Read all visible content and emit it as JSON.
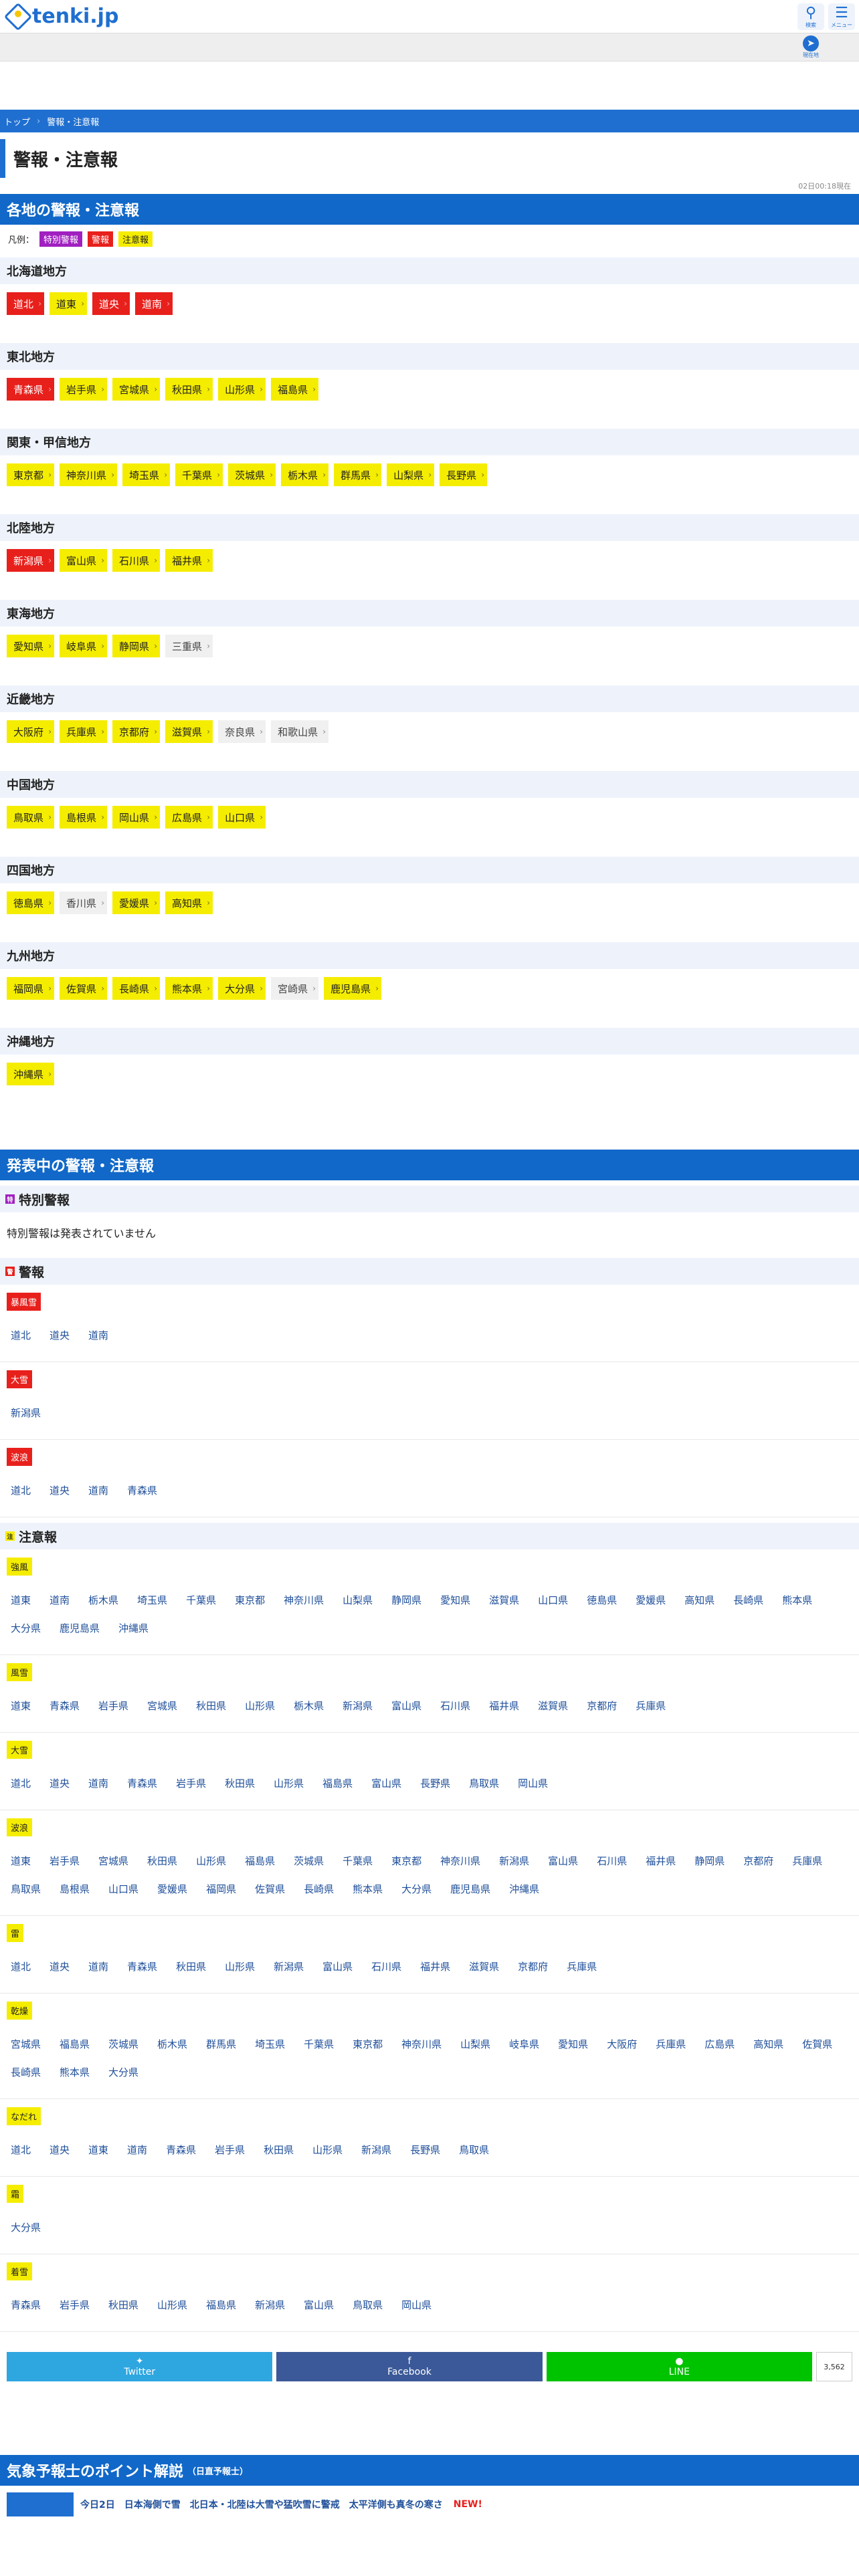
{
  "site": {
    "logo": "tenki.jp"
  },
  "header": {
    "search_label": "検索",
    "menu_label": "メニュー"
  },
  "subbar": {
    "location_label": "現在地"
  },
  "breadcrumb": [
    "トップ",
    "警報・注意報"
  ],
  "page_title": "警報・注意報",
  "as_of": "02日00:18現在",
  "section1_title": "各地の警報・注意報",
  "legend": {
    "label": "凡例：",
    "special": "特別警報",
    "warning": "警報",
    "advisory": "注意報"
  },
  "regions": [
    {
      "name": "北海道地方",
      "areas": [
        {
          "n": "道北",
          "s": "w"
        },
        {
          "n": "道東",
          "s": "a"
        },
        {
          "n": "道央",
          "s": "w"
        },
        {
          "n": "道南",
          "s": "w"
        }
      ]
    },
    {
      "name": "東北地方",
      "areas": [
        {
          "n": "青森県",
          "s": "w"
        },
        {
          "n": "岩手県",
          "s": "a"
        },
        {
          "n": "宮城県",
          "s": "a"
        },
        {
          "n": "秋田県",
          "s": "a"
        },
        {
          "n": "山形県",
          "s": "a"
        },
        {
          "n": "福島県",
          "s": "a"
        }
      ]
    },
    {
      "name": "関東・甲信地方",
      "areas": [
        {
          "n": "東京都",
          "s": "a"
        },
        {
          "n": "神奈川県",
          "s": "a"
        },
        {
          "n": "埼玉県",
          "s": "a"
        },
        {
          "n": "千葉県",
          "s": "a"
        },
        {
          "n": "茨城県",
          "s": "a"
        },
        {
          "n": "栃木県",
          "s": "a"
        },
        {
          "n": "群馬県",
          "s": "a"
        },
        {
          "n": "山梨県",
          "s": "a"
        },
        {
          "n": "長野県",
          "s": "a"
        }
      ]
    },
    {
      "name": "北陸地方",
      "areas": [
        {
          "n": "新潟県",
          "s": "w"
        },
        {
          "n": "富山県",
          "s": "a"
        },
        {
          "n": "石川県",
          "s": "a"
        },
        {
          "n": "福井県",
          "s": "a"
        }
      ]
    },
    {
      "name": "東海地方",
      "areas": [
        {
          "n": "愛知県",
          "s": "a"
        },
        {
          "n": "岐阜県",
          "s": "a"
        },
        {
          "n": "静岡県",
          "s": "a"
        },
        {
          "n": "三重県",
          "s": "n"
        }
      ]
    },
    {
      "name": "近畿地方",
      "areas": [
        {
          "n": "大阪府",
          "s": "a"
        },
        {
          "n": "兵庫県",
          "s": "a"
        },
        {
          "n": "京都府",
          "s": "a"
        },
        {
          "n": "滋賀県",
          "s": "a"
        },
        {
          "n": "奈良県",
          "s": "n"
        },
        {
          "n": "和歌山県",
          "s": "n"
        }
      ]
    },
    {
      "name": "中国地方",
      "areas": [
        {
          "n": "鳥取県",
          "s": "a"
        },
        {
          "n": "島根県",
          "s": "a"
        },
        {
          "n": "岡山県",
          "s": "a"
        },
        {
          "n": "広島県",
          "s": "a"
        },
        {
          "n": "山口県",
          "s": "a"
        }
      ]
    },
    {
      "name": "四国地方",
      "areas": [
        {
          "n": "徳島県",
          "s": "a"
        },
        {
          "n": "香川県",
          "s": "n"
        },
        {
          "n": "愛媛県",
          "s": "a"
        },
        {
          "n": "高知県",
          "s": "a"
        }
      ]
    },
    {
      "name": "九州地方",
      "areas": [
        {
          "n": "福岡県",
          "s": "a"
        },
        {
          "n": "佐賀県",
          "s": "a"
        },
        {
          "n": "長崎県",
          "s": "a"
        },
        {
          "n": "熊本県",
          "s": "a"
        },
        {
          "n": "大分県",
          "s": "a"
        },
        {
          "n": "宮崎県",
          "s": "n"
        },
        {
          "n": "鹿児島県",
          "s": "a"
        }
      ]
    },
    {
      "name": "沖縄地方",
      "areas": [
        {
          "n": "沖縄県",
          "s": "a"
        }
      ]
    }
  ],
  "section2_title": "発表中の警報・注意報",
  "special": {
    "title": "特別警報",
    "none": "特別警報は発表されていません"
  },
  "warnings": {
    "title": "警報",
    "kinds": [
      {
        "k": "暴風雪",
        "areas": [
          "道北",
          "道央",
          "道南"
        ]
      },
      {
        "k": "大雪",
        "areas": [
          "新潟県"
        ]
      },
      {
        "k": "波浪",
        "areas": [
          "道北",
          "道央",
          "道南",
          "青森県"
        ]
      }
    ]
  },
  "advisories": {
    "title": "注意報",
    "kinds": [
      {
        "k": "強風",
        "areas": [
          "道東",
          "道南",
          "栃木県",
          "埼玉県",
          "千葉県",
          "東京都",
          "神奈川県",
          "山梨県",
          "静岡県",
          "愛知県",
          "滋賀県",
          "山口県",
          "徳島県",
          "愛媛県",
          "高知県",
          "長崎県",
          "熊本県",
          "大分県",
          "鹿児島県",
          "沖縄県"
        ]
      },
      {
        "k": "風雪",
        "areas": [
          "道東",
          "青森県",
          "岩手県",
          "宮城県",
          "秋田県",
          "山形県",
          "栃木県",
          "新潟県",
          "富山県",
          "石川県",
          "福井県",
          "滋賀県",
          "京都府",
          "兵庫県"
        ]
      },
      {
        "k": "大雪",
        "areas": [
          "道北",
          "道央",
          "道南",
          "青森県",
          "岩手県",
          "秋田県",
          "山形県",
          "福島県",
          "富山県",
          "長野県",
          "鳥取県",
          "岡山県"
        ]
      },
      {
        "k": "波浪",
        "areas": [
          "道東",
          "岩手県",
          "宮城県",
          "秋田県",
          "山形県",
          "福島県",
          "茨城県",
          "千葉県",
          "東京都",
          "神奈川県",
          "新潟県",
          "富山県",
          "石川県",
          "福井県",
          "静岡県",
          "京都府",
          "兵庫県",
          "鳥取県",
          "島根県",
          "山口県",
          "愛媛県",
          "福岡県",
          "佐賀県",
          "長崎県",
          "熊本県",
          "大分県",
          "鹿児島県",
          "沖縄県"
        ]
      },
      {
        "k": "雷",
        "areas": [
          "道北",
          "道央",
          "道南",
          "青森県",
          "秋田県",
          "山形県",
          "新潟県",
          "富山県",
          "石川県",
          "福井県",
          "滋賀県",
          "京都府",
          "兵庫県"
        ]
      },
      {
        "k": "乾燥",
        "areas": [
          "宮城県",
          "福島県",
          "茨城県",
          "栃木県",
          "群馬県",
          "埼玉県",
          "千葉県",
          "東京都",
          "神奈川県",
          "山梨県",
          "岐阜県",
          "愛知県",
          "大阪府",
          "兵庫県",
          "広島県",
          "高知県",
          "佐賀県",
          "長崎県",
          "熊本県",
          "大分県"
        ]
      },
      {
        "k": "なだれ",
        "areas": [
          "道北",
          "道央",
          "道東",
          "道南",
          "青森県",
          "岩手県",
          "秋田県",
          "山形県",
          "新潟県",
          "長野県",
          "鳥取県"
        ]
      },
      {
        "k": "霜",
        "areas": [
          "大分県"
        ]
      },
      {
        "k": "着雪",
        "areas": [
          "青森県",
          "岩手県",
          "秋田県",
          "山形県",
          "福島県",
          "新潟県",
          "富山県",
          "鳥取県",
          "岡山県"
        ]
      }
    ]
  },
  "share": {
    "twitter": "Twitter",
    "facebook": "Facebook",
    "line": "LINE",
    "count": "3,562"
  },
  "section3_title": "気象予報士のポイント解説",
  "section3_sub": "（日直予報士）",
  "point": {
    "text": "今日2日　日本海側で雪　北日本・北陸は大雪や猛吹雪に警戒　太平洋側も真冬の寒さ",
    "new": "NEW!"
  }
}
